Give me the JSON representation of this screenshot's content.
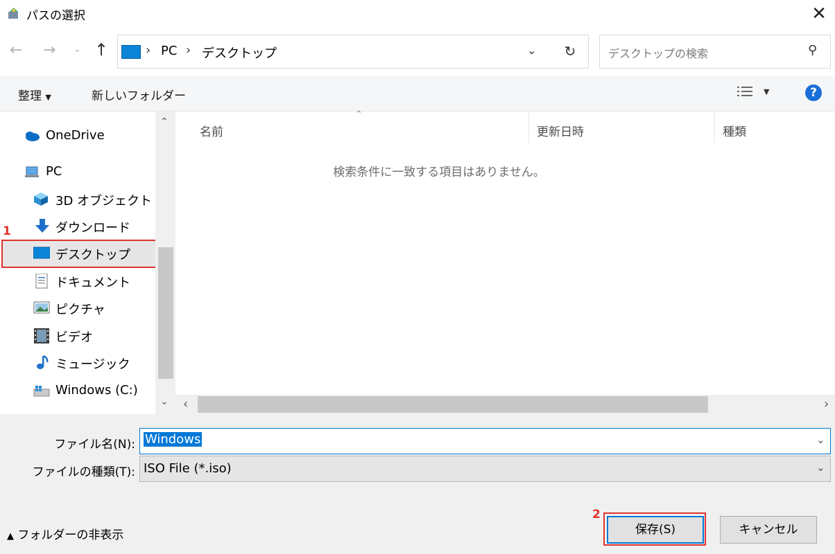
{
  "window": {
    "title": "パスの選択"
  },
  "address": {
    "segments": [
      "PC",
      "デスクトップ"
    ],
    "search_placeholder": "デスクトップの検索"
  },
  "toolbar": {
    "organize": "整理",
    "new_folder": "新しいフォルダー"
  },
  "nav": {
    "onedrive": "OneDrive",
    "pc": "PC",
    "items": [
      "3D オブジェクト",
      "ダウンロード",
      "デスクトップ",
      "ドキュメント",
      "ピクチャ",
      "ビデオ",
      "ミュージック",
      "Windows (C:)"
    ]
  },
  "content": {
    "columns": [
      "名前",
      "更新日時",
      "種類"
    ],
    "empty_message": "検索条件に一致する項目はありません。"
  },
  "form": {
    "filename_label": "ファイル名(N):",
    "filename_value": "Windows",
    "filetype_label": "ファイルの種類(T):",
    "filetype_value": "ISO File (*.iso)"
  },
  "footer": {
    "hide_folders": "フォルダーの非表示",
    "save": "保存(S)",
    "cancel": "キャンセル"
  },
  "annotations": {
    "step1": "1",
    "step2": "2"
  },
  "colors": {
    "accent": "#0078d7",
    "annotation": "#e0322d"
  }
}
